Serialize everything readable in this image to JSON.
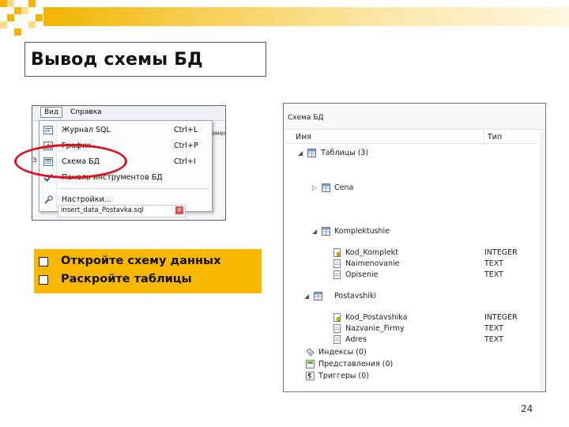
{
  "slide": {
    "title": "Вывод схемы БД",
    "page_number": "24"
  },
  "menu_screenshot": {
    "menubar": [
      "Вид",
      "Справка"
    ],
    "items": [
      {
        "label": "Журнал SQL",
        "shortcut": "Ctrl+L",
        "icon": "sql-log-icon"
      },
      {
        "label": "График",
        "shortcut": "Ctrl+P",
        "icon": "chart-icon"
      },
      {
        "label": "Схема БД",
        "shortcut": "Ctrl+I",
        "icon": "schema-icon"
      },
      {
        "label": "Панель инструментов БД",
        "shortcut": "",
        "icon": "checkmark-icon"
      },
      {
        "label": "Настройки...",
        "shortcut": "",
        "icon": "wrench-icon"
      }
    ],
    "tab_label": "insert_data_Postavka.sql",
    "fragment_right": "емен",
    "fragment_left": "Э"
  },
  "instructions": [
    "Откройте схему данных",
    "Раскройте таблицы"
  ],
  "schema": {
    "caption": "Схема БД",
    "col_name": "Имя",
    "col_type": "Тип",
    "tables_label": "Таблицы (3)",
    "tables": [
      {
        "name": "Cena",
        "expanded": false,
        "fields": []
      },
      {
        "name": "Komplektushie",
        "expanded": true,
        "fields": [
          {
            "name": "Kod_Komplekt",
            "type": "INTEGER",
            "key": true
          },
          {
            "name": "Naimenovanie",
            "type": "TEXT",
            "key": false
          },
          {
            "name": "Opisenie",
            "type": "TEXT",
            "key": false
          }
        ]
      },
      {
        "name": "Postavshiki",
        "expanded": true,
        "fields": [
          {
            "name": "Kod_Postavshika",
            "type": "INTEGER",
            "key": true
          },
          {
            "name": "Nazvanie_Firmy",
            "type": "TEXT",
            "key": false
          },
          {
            "name": "Adres",
            "type": "TEXT",
            "key": false
          }
        ]
      }
    ],
    "indexes_label": "Индексы (0)",
    "views_label": "Представления (0)",
    "triggers_label": "Триггеры (0)"
  },
  "colors": {
    "accent_yellow": "#f8b800",
    "oval_red": "#d9141d"
  }
}
